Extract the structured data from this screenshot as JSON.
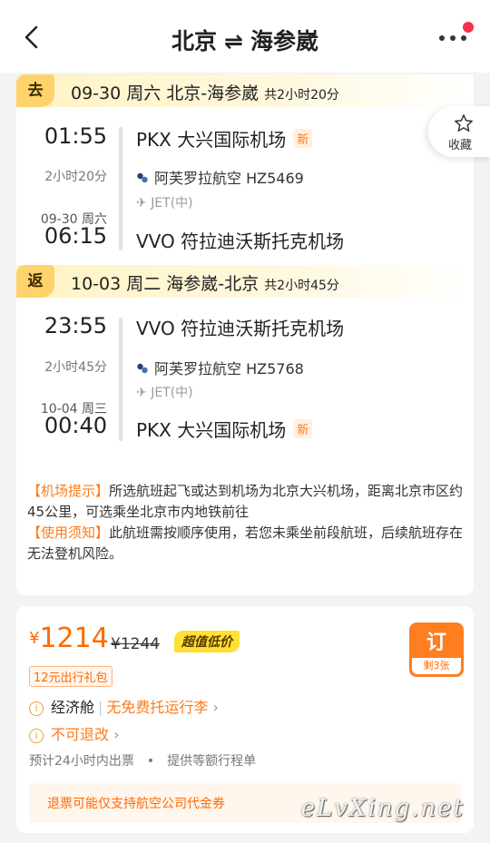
{
  "header": {
    "from_city": "北京",
    "swap_symbol": "⇌",
    "to_city": "海参崴"
  },
  "favorite": {
    "label": "收藏"
  },
  "outbound": {
    "badge": "去",
    "summary": "09-30 周六 北京-海参崴",
    "duration_total": "共2小时20分",
    "depart_time": "01:55",
    "depart_airport": "PKX 大兴国际机场",
    "depart_new_tag": "新",
    "flight_duration": "2小时20分",
    "airline": "阿芙罗拉航空 HZ5469",
    "aircraft": "JET(中)",
    "arrive_date": "09-30 周六",
    "arrive_time": "06:15",
    "arrive_airport": "VVO 符拉迪沃斯托克机场"
  },
  "return": {
    "badge": "返",
    "summary": "10-03 周二 海参崴-北京",
    "duration_total": "共2小时45分",
    "depart_time": "23:55",
    "depart_airport": "VVO 符拉迪沃斯托克机场",
    "flight_duration": "2小时45分",
    "airline": "阿芙罗拉航空 HZ5768",
    "aircraft": "JET(中)",
    "arrive_date": "10-04 周三",
    "arrive_time": "00:40",
    "arrive_airport": "PKX 大兴国际机场",
    "arrive_new_tag": "新"
  },
  "tips": {
    "airport_key": "【机场提示】",
    "airport_text": "所选航班起飞或达到机场为北京大兴机场，距离北京市区约45公里，可选乘坐北京市内地铁前往",
    "usage_key": "【使用须知】",
    "usage_text": "此航班需按顺序使用，若您未乘坐前段航班，后续航班存在无法登机风险。"
  },
  "price_card": {
    "currency": "¥",
    "price": "1214",
    "old_price": "¥1244",
    "deal_tag": "超值低价",
    "gift": "12元出行礼包",
    "book_label": "订",
    "remaining": "剩3张",
    "cabin": "经济舱",
    "baggage": "无免费托运行李",
    "refund_policy": "不可退改",
    "ticketing": "预计24小时内出票",
    "bullet": "•",
    "itinerary": "提供等额行程单",
    "refund_note": "退票可能仅支持航空公司代金券"
  },
  "watermark": "eLvXing.net",
  "colors": {
    "accent": "#ff6a00",
    "badge_yellow": "#ffd36b",
    "deal_yellow": "#ffe033"
  }
}
